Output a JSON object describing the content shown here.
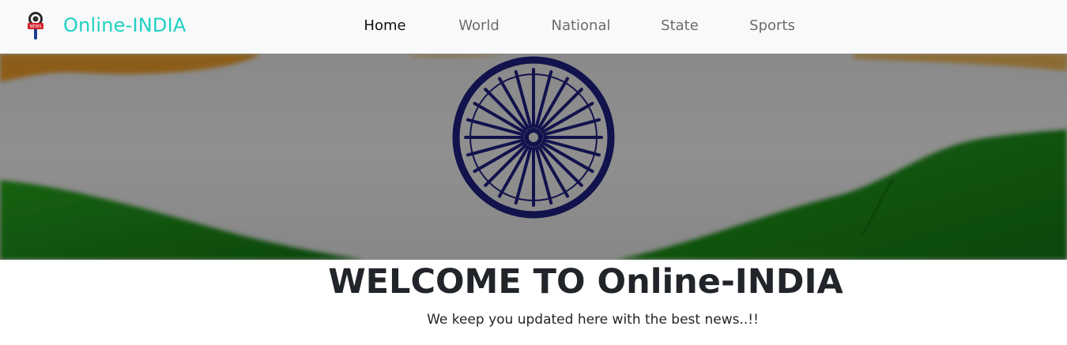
{
  "brand": {
    "name": "Online-INDIA",
    "logo_icon": "news-microphone-icon",
    "color": "#1fd1c1"
  },
  "nav": {
    "items": [
      {
        "label": "Home",
        "active": true
      },
      {
        "label": "World",
        "active": false
      },
      {
        "label": "National",
        "active": false
      },
      {
        "label": "State",
        "active": false
      },
      {
        "label": "Sports",
        "active": false
      }
    ]
  },
  "hero": {
    "image": "indian-flag-banner",
    "colors": {
      "saffron": "#f0a030",
      "white": "#f4f4f4",
      "green": "#1d9a1a",
      "chakra": "#1f1f8c"
    }
  },
  "welcome": {
    "title": "WELCOME TO Online-INDIA",
    "subtitle": "We keep you updated here with the best news..!!"
  }
}
